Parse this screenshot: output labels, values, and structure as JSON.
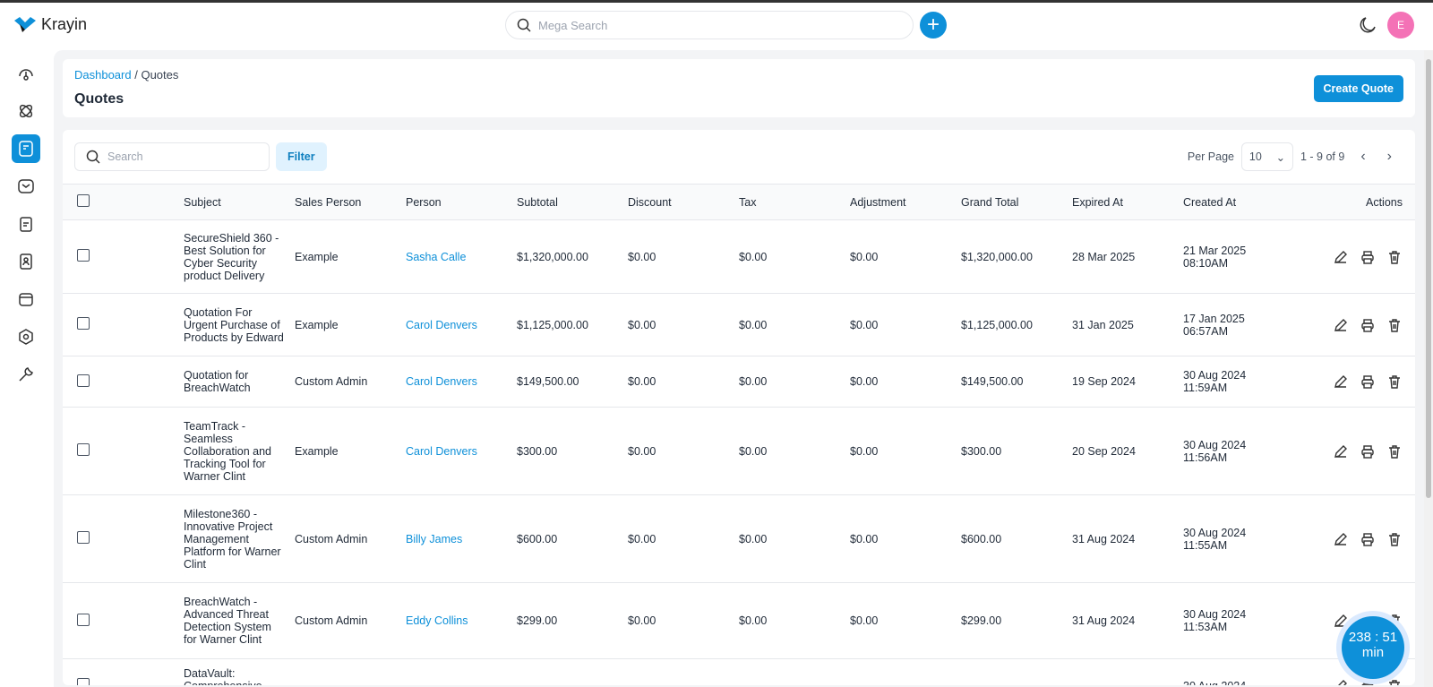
{
  "app": {
    "name": "Krayin",
    "search_placeholder": "Mega Search",
    "avatar_letter": "E"
  },
  "breadcrumb": {
    "parent": "Dashboard",
    "current": "Quotes"
  },
  "page_title": "Quotes",
  "create_label": "Create Quote",
  "toolbar": {
    "search_placeholder": "Search",
    "filter_label": "Filter",
    "per_page_label": "Per Page",
    "per_page": "10",
    "range": "1 - 9 of 9"
  },
  "columns": [
    "Subject",
    "Sales Person",
    "Person",
    "Subtotal",
    "Discount",
    "Tax",
    "Adjustment",
    "Grand Total",
    "Expired At",
    "Created At",
    "Actions"
  ],
  "rows": [
    {
      "subject": "SecureShield 360 - Best Solution for Cyber Security product Delivery",
      "sales": "Example",
      "person": "Sasha Calle",
      "subtotal": "$1,320,000.00",
      "discount": "$0.00",
      "tax": "$0.00",
      "adjustment": "$0.00",
      "grand": "$1,320,000.00",
      "expired": "28 Mar 2025",
      "created": "21 Mar 2025 08:10AM"
    },
    {
      "subject": "Quotation For Urgent Purchase of Products by Edward",
      "sales": "Example",
      "person": "Carol Denvers",
      "subtotal": "$1,125,000.00",
      "discount": "$0.00",
      "tax": "$0.00",
      "adjustment": "$0.00",
      "grand": "$1,125,000.00",
      "expired": "31 Jan 2025",
      "created": "17 Jan 2025 06:57AM"
    },
    {
      "subject": "Quotation for BreachWatch",
      "sales": "Custom Admin",
      "person": "Carol Denvers",
      "subtotal": "$149,500.00",
      "discount": "$0.00",
      "tax": "$0.00",
      "adjustment": "$0.00",
      "grand": "$149,500.00",
      "expired": "19 Sep 2024",
      "created": "30 Aug 2024 11:59AM"
    },
    {
      "subject": "TeamTrack - Seamless Collaboration and Tracking Tool for Warner Clint",
      "sales": "Example",
      "person": "Carol Denvers",
      "subtotal": "$300.00",
      "discount": "$0.00",
      "tax": "$0.00",
      "adjustment": "$0.00",
      "grand": "$300.00",
      "expired": "20 Sep 2024",
      "created": "30 Aug 2024 11:56AM"
    },
    {
      "subject": "Milestone360 - Innovative Project Management Platform for Warner Clint",
      "sales": "Custom Admin",
      "person": "Billy James",
      "subtotal": "$600.00",
      "discount": "$0.00",
      "tax": "$0.00",
      "adjustment": "$0.00",
      "grand": "$600.00",
      "expired": "31 Aug 2024",
      "created": "30 Aug 2024 11:55AM"
    },
    {
      "subject": "BreachWatch - Advanced Threat Detection System for Warner Clint",
      "sales": "Custom Admin",
      "person": "Eddy Collins",
      "subtotal": "$299.00",
      "discount": "$0.00",
      "tax": "$0.00",
      "adjustment": "$0.00",
      "grand": "$299.00",
      "expired": "31 Aug 2024",
      "created": "30 Aug 2024 11:53AM"
    },
    {
      "subject": "DataVault: Comprehensive Data",
      "sales": "",
      "person": "",
      "subtotal": "",
      "discount": "",
      "tax": "",
      "adjustment": "",
      "grand": "",
      "expired": "",
      "created": "30 Aug 2024"
    }
  ],
  "timer": {
    "value": "238 : 51",
    "unit": "min"
  }
}
